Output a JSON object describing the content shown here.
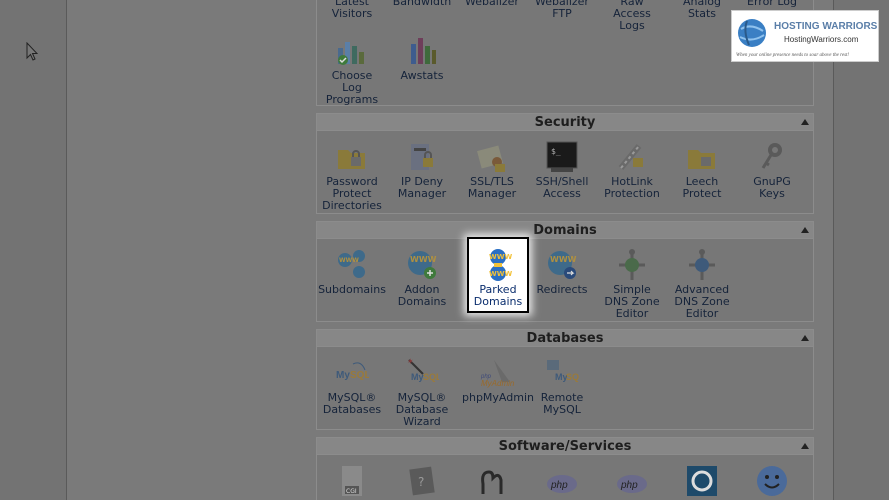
{
  "top_section": {
    "items": [
      {
        "label": "Latest\nVisitors"
      },
      {
        "label": "Bandwidth"
      },
      {
        "label": "Webalizer"
      },
      {
        "label": "Webalizer\nFTP"
      },
      {
        "label": "Raw\nAccess\nLogs"
      },
      {
        "label": "Analog\nStats"
      },
      {
        "label": "Error Log"
      }
    ],
    "row2": [
      {
        "label": "Choose\nLog\nPrograms"
      },
      {
        "label": "Awstats"
      }
    ]
  },
  "security": {
    "title": "Security",
    "items": [
      {
        "label": "Password\nProtect\nDirectories"
      },
      {
        "label": "IP Deny\nManager"
      },
      {
        "label": "SSL/TLS\nManager"
      },
      {
        "label": "SSH/Shell\nAccess"
      },
      {
        "label": "HotLink\nProtection"
      },
      {
        "label": "Leech\nProtect"
      },
      {
        "label": "GnuPG\nKeys"
      }
    ]
  },
  "domains": {
    "title": "Domains",
    "items": [
      {
        "label": "Subdomains"
      },
      {
        "label": "Addon\nDomains"
      },
      {
        "label": "Parked\nDomains"
      },
      {
        "label": "Redirects"
      },
      {
        "label": "Simple\nDNS Zone\nEditor"
      },
      {
        "label": "Advanced\nDNS Zone\nEditor"
      }
    ]
  },
  "databases": {
    "title": "Databases",
    "items": [
      {
        "label": "MySQL®\nDatabases"
      },
      {
        "label": "MySQL®\nDatabase\nWizard"
      },
      {
        "label": "phpMyAdmin"
      },
      {
        "label": "Remote\nMySQL"
      }
    ]
  },
  "software": {
    "title": "Software/Services"
  },
  "logo": {
    "title": "HOSTING WARRIORS",
    "domain": "HostingWarriors.com",
    "tagline": "When your online presence needs to soar above the rest!"
  },
  "colors": {
    "overlay_gray": "#7a7a7a",
    "header_bg": "#878787",
    "link_blue": "#15233a",
    "highlight_bg": "#ffffff"
  }
}
